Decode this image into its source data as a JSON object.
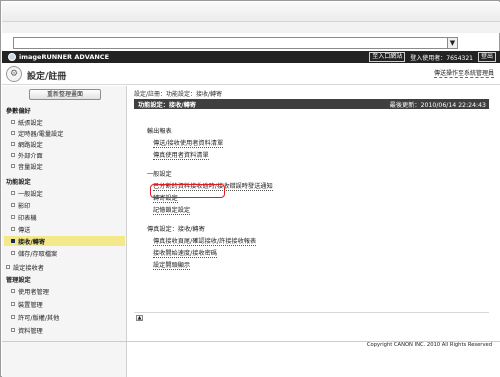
{
  "browser": {
    "dropdown_arrow": "▼"
  },
  "app": {
    "brand": "imageRUNNER ADVANCE",
    "links": [
      "至入口網站",
      "登入使用者：7654321",
      "登出"
    ],
    "page_title": "設定/註冊",
    "device_link": "傳送操作至系統管理員"
  },
  "sidebar": {
    "update_button": "重新整理畫面",
    "sections": [
      {
        "title": "參數偏好",
        "items": [
          "紙張設定",
          "定時器/電量設定",
          "網路設定",
          "外部介面",
          "音量設定"
        ]
      },
      {
        "title": "功能設定",
        "items": [
          "一般設定",
          "影印",
          "印表機",
          "傳送",
          "接收/轉寄",
          "儲存/存取檔案"
        ]
      },
      {
        "title": "",
        "items": [
          "設定接收者"
        ]
      },
      {
        "title": "管理設定",
        "items": [
          "使用者管理",
          "裝置管理",
          "許可/版權/其他",
          "資料管理"
        ]
      }
    ],
    "selected": "接收/轉寄"
  },
  "main": {
    "breadcrumb": "設定/註冊：功能設定：接收/轉寄",
    "header": "功能設定：接收/轉寄",
    "last_updated": "最後更新：2010/06/14 22:24:43",
    "groups": [
      {
        "title": "輸出報表",
        "links": [
          "傳送/接收使用者資料清單",
          "傳真使用者資料清單"
        ]
      },
      {
        "title": "一般設定",
        "links": [
          "已分割的資料接收逾時/接收錯誤時發送通知",
          "轉寄設定",
          "記憶鎖定設定"
        ]
      },
      {
        "title": "傳真設定：接收/轉寄",
        "links": [
          "傳真接收頁尾/確認接收/許接接收報表",
          "接收開始速度/接收密碼",
          "設定開頭顯示"
        ]
      }
    ],
    "highlighted_link": "轉寄設定",
    "scroll_top": "▲"
  },
  "footer": {
    "copyright": "Copyright CANON INC. 2010 All Rights Reserved"
  },
  "colors": {
    "topbar": "#232323",
    "selected": "#f4e98a",
    "highlight": "#e01c1c",
    "header_bar": "#3f3f3f"
  }
}
